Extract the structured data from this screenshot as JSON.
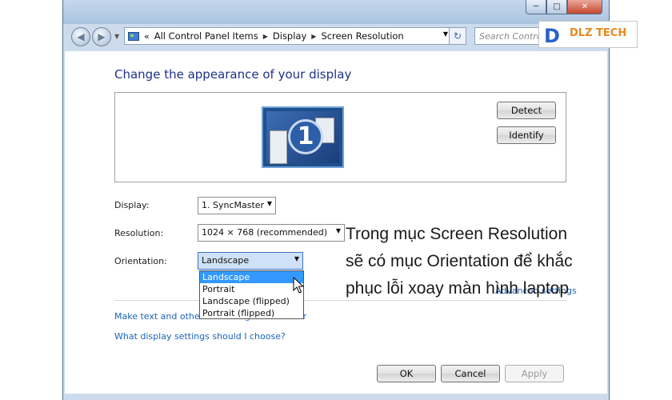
{
  "window": {
    "caption_buttons": [
      "minimize-icon",
      "maximize-icon",
      "close-icon"
    ],
    "address": {
      "overflow": "«",
      "crumbs": [
        "All Control Panel Items",
        "Display",
        "Screen Resolution"
      ]
    },
    "search_placeholder": "Search Contro"
  },
  "content": {
    "heading": "Change the appearance of your display",
    "monitor_number": "1",
    "detect_label": "Detect",
    "identify_label": "Identify",
    "display_label": "Display:",
    "display_value": "1. SyncMaster",
    "resolution_label": "Resolution:",
    "resolution_value": "1024 × 768 (recommended)",
    "orientation_label": "Orientation:",
    "orientation_value": "Landscape",
    "orientation_options": [
      "Landscape",
      "Portrait",
      "Landscape (flipped)",
      "Portrait (flipped)"
    ],
    "advanced_link": "Advanced settings",
    "link_text_size": "Make text and other items larger or smaller",
    "link_which_settings": "What display settings should I choose?",
    "ok_label": "OK",
    "cancel_label": "Cancel",
    "apply_label": "Apply"
  },
  "overlay": {
    "logo_letter": "D",
    "logo_text": "DLZ TECH",
    "caption_lines": [
      "Trong mục Screen Resolution",
      "sẽ có mục Orientation để khắc",
      "phục lỗi xoay màn hình laptop"
    ]
  },
  "colors": {
    "heading": "#1e3287",
    "link": "#1d64b6",
    "selection": "#3399ff",
    "logo_blue": "#2a62c9",
    "logo_orange": "#e58a1f"
  }
}
